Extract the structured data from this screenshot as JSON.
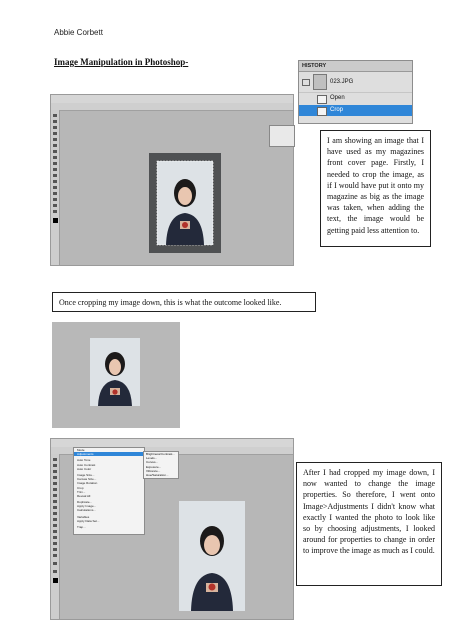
{
  "author": "Abbie Corbett",
  "heading": "Image Manipulation in Photoshop-",
  "history_panel": {
    "title": "HISTORY",
    "items": [
      {
        "label": "023.JPG",
        "selected": false
      },
      {
        "label": "Open",
        "selected": false
      },
      {
        "label": "Crop",
        "selected": true
      }
    ],
    "selected_color": "#2f86d8"
  },
  "textboxes": {
    "crop_explanation": "I am showing an image that I have used as my magazines front cover page. Firstly, I needed to crop the image, as if I would have put it onto my magazine as big as the image was taken, when adding the text, the image would be getting paid less attention to.",
    "crop_outcome": "Once cropping my image down, this is what the outcome looked like.",
    "adjustments_explanation": "After I had cropped my image down, I now wanted to change the image properties. So therefore, I went onto Image>Adjustments I didn't know what exactly I wanted the photo to look like so by choosing adjustments, I looked around for properties to change in order to improve the image as much as I could."
  },
  "image_menu": {
    "items": [
      "Mode",
      "Adjustments",
      "",
      "Auto Tone",
      "Auto Contrast",
      "Auto Color",
      "",
      "Image Size...",
      "Canvas Size...",
      "Image Rotation",
      "Crop",
      "Trim...",
      "Reveal All",
      "",
      "Duplicate...",
      "Apply Image...",
      "Calculations...",
      "",
      "Variables",
      "Apply Data Set...",
      "",
      "Trap..."
    ],
    "submenu": [
      "Brightness/Contrast...",
      "Levels...",
      "Curves...",
      "Exposure...",
      "Vibrance...",
      "Hue/Saturation..."
    ]
  }
}
